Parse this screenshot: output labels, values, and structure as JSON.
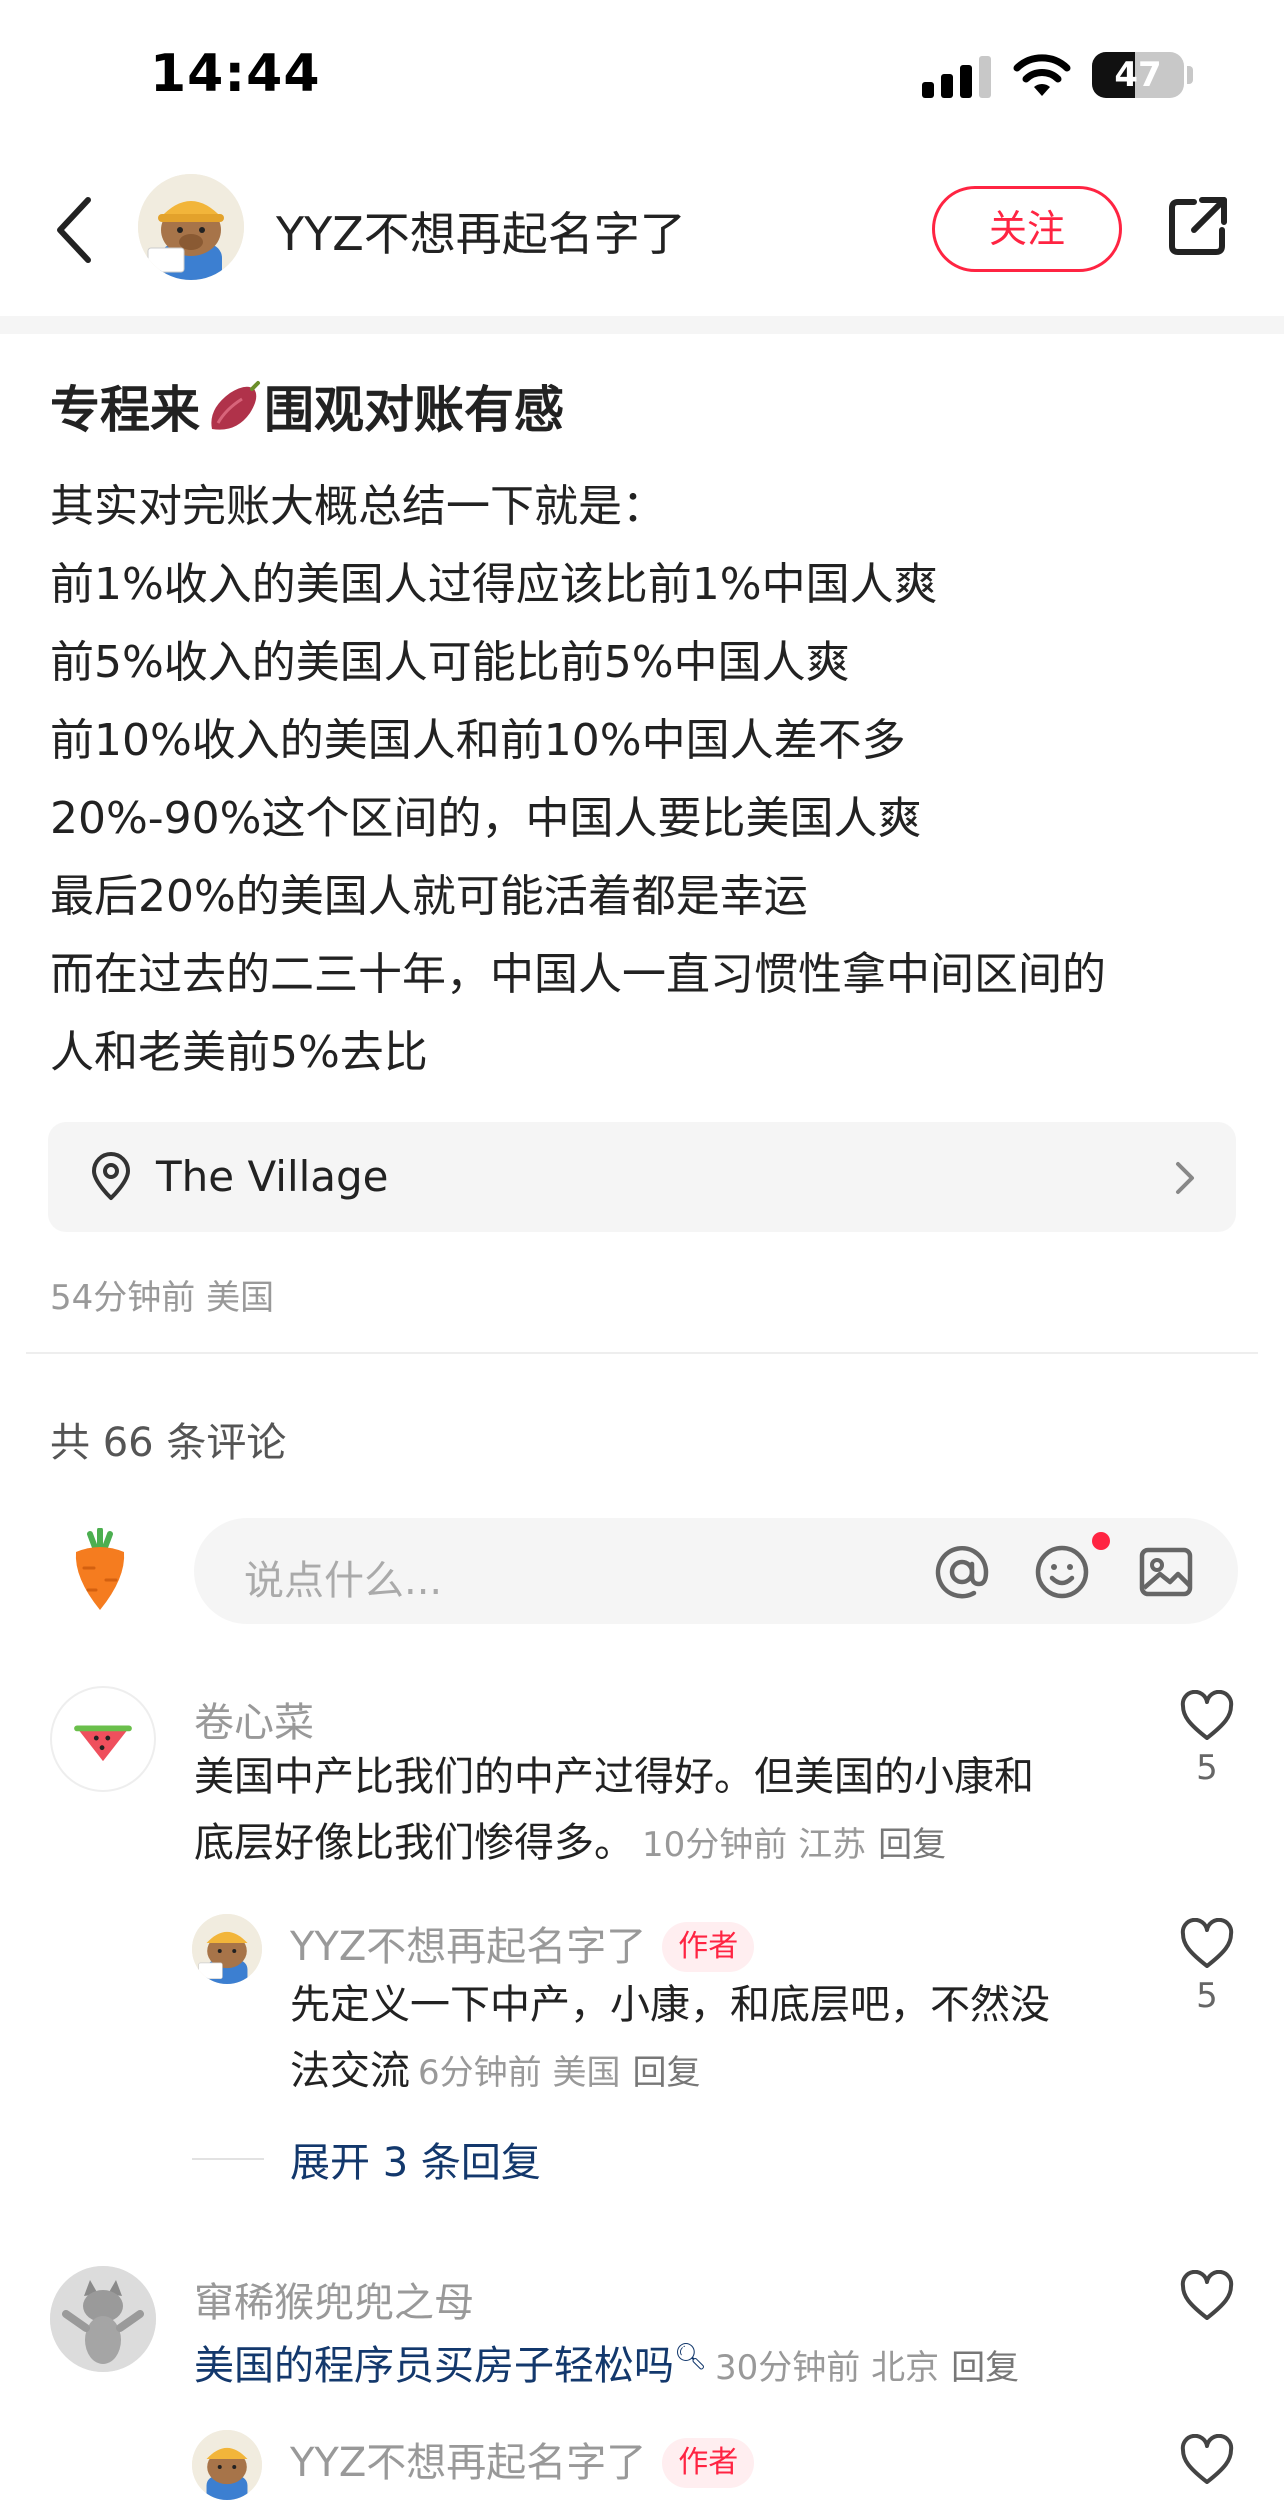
{
  "status_bar": {
    "time": "14:44",
    "battery": "47",
    "battery_level": 0.47
  },
  "header": {
    "author_name": "YYZ不想再起名字了",
    "follow_label": "关注"
  },
  "post": {
    "title_before": "专程来",
    "title_emoji": "sweet-potato-emoji",
    "title_after": "围观对账有感",
    "lines": [
      "其实对完账大概总结一下就是：",
      "前1%收入的美国人过得应该比前1%中国人爽",
      "前5%收入的美国人可能比前5%中国人爽",
      "前10%收入的美国人和前10%中国人差不多",
      "20%-90%这个区间的，中国人要比美国人爽",
      "最后20%的美国人就可能活着都是幸运",
      "而在过去的二三十年，中国人一直习惯性拿中间区间的",
      "人和老美前5%去比"
    ],
    "location": "The Village",
    "meta": "54分钟前 美国"
  },
  "comments_header": {
    "count_label": "共 66 条评论"
  },
  "comment_input": {
    "placeholder": "说点什么..."
  },
  "comments": [
    {
      "name": "卷心菜",
      "text_line1": "美国中产比我们的中产过得好。但美国的小康和",
      "text_line2": "底层好像比我们惨得多。",
      "meta": "10分钟前 江苏",
      "reply_label": "回复",
      "likes": "5",
      "replies": [
        {
          "name": "YYZ不想再起名字了",
          "tag": "作者",
          "text_line1": "先定义一下中产，小康，和底层吧，不然没",
          "text_line2": "法交流",
          "meta": "6分钟前 美国",
          "reply_label": "回复",
          "likes": "5"
        }
      ],
      "expand_label": "展开 3 条回复"
    },
    {
      "name": "窜稀猴兜兜之母",
      "text": "美国的程序员买房子轻松吗",
      "meta": "30分钟前 北京",
      "reply_label": "回复",
      "replies": [
        {
          "name": "YYZ不想再起名字了",
          "tag": "作者"
        }
      ]
    }
  ],
  "colors": {
    "accent": "#ff2442",
    "link": "#13386c",
    "muted": "#999999"
  }
}
